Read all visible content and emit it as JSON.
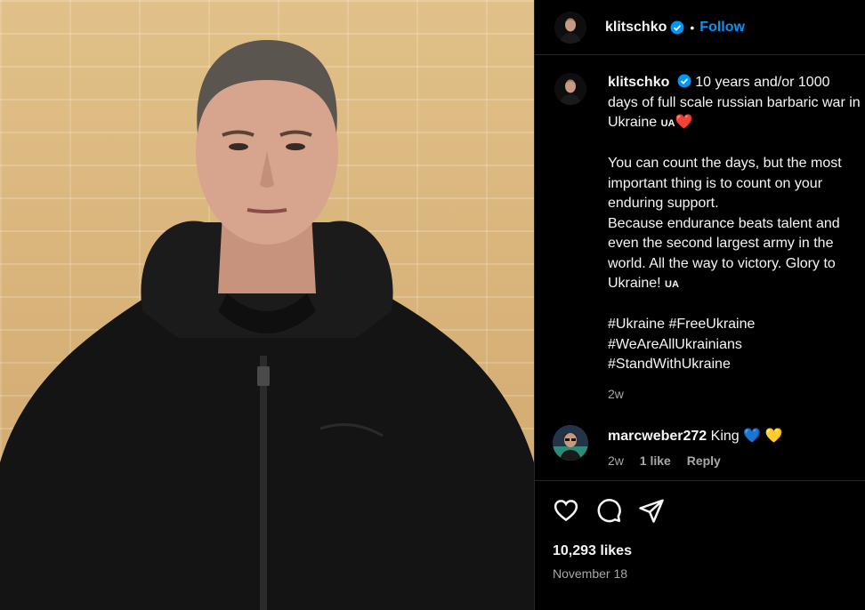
{
  "post": {
    "username": "klitschko",
    "follow_label": "Follow",
    "dot": "•",
    "caption": {
      "author": "klitschko",
      "line1": "10 years and/or 1000 days of full scale russian barbaric war in Ukraine",
      "flag1": "UA",
      "heart": "❤️",
      "line2": "You can count the days, but the most important thing is to count on your enduring support.",
      "line3": "Because endurance beats talent and even the second largest army in the world. All the way to victory. Glory to Ukraine!",
      "flag2": "UA",
      "hashtags": [
        "#Ukraine #FreeUkraine",
        "#WeAreAllUkrainians",
        "#StandWithUkraine"
      ],
      "time": "2w"
    },
    "comment": {
      "author": "marcweber272",
      "text": "King",
      "hearts": "💙 💛",
      "time": "2w",
      "likes": "1 like",
      "reply": "Reply"
    },
    "likes": "10,293 likes",
    "date": "November 18"
  },
  "icons": {
    "like": "heart-icon",
    "comment": "comment-icon",
    "share": "share-icon",
    "verified": "verified-badge-icon"
  },
  "colors": {
    "accent": "#0095f6",
    "verified": "#0095f6",
    "background": "#000000",
    "muted": "#a8a8a8"
  }
}
